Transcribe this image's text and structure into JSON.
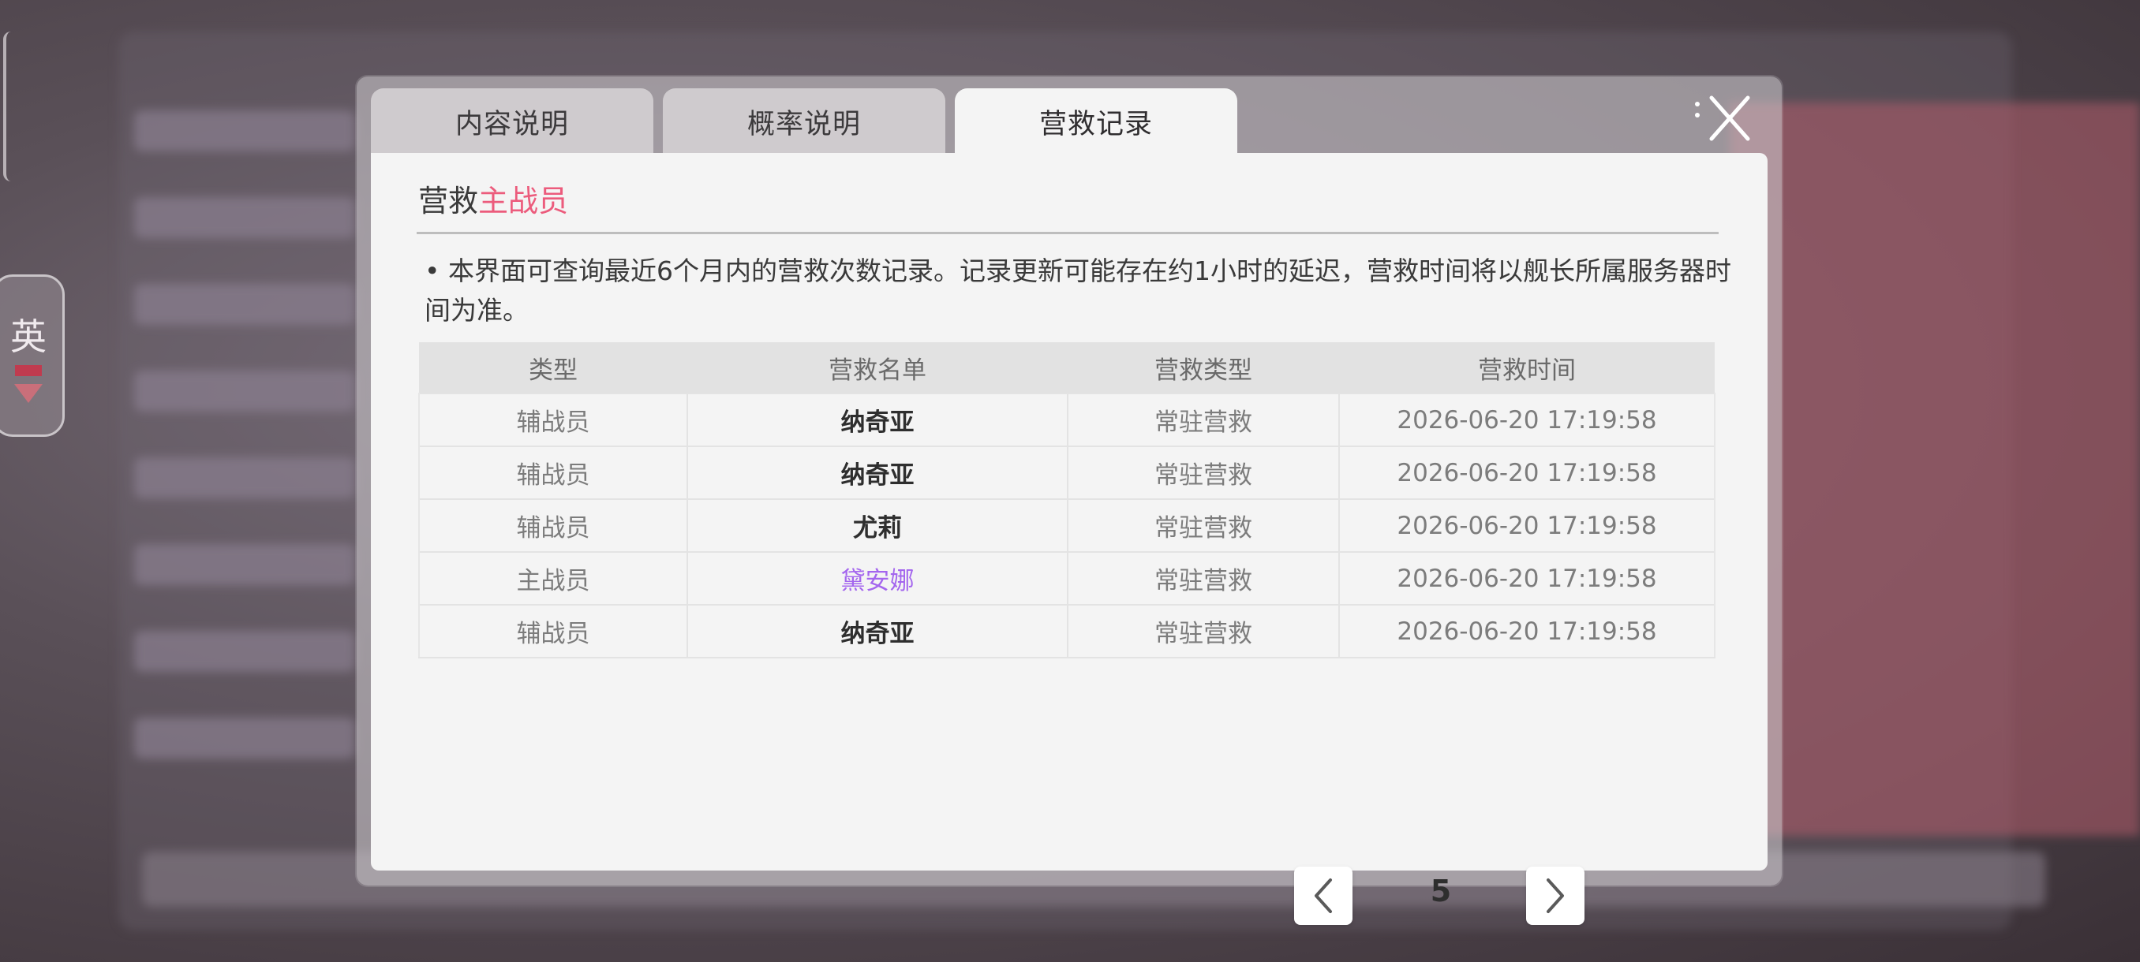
{
  "side_widget": {
    "glyph": "英"
  },
  "tabs": [
    {
      "label": "内容说明",
      "active": false
    },
    {
      "label": "概率说明",
      "active": false
    },
    {
      "label": "营救记录",
      "active": true
    }
  ],
  "section": {
    "title_prefix": "营救",
    "title_accent": "主战员",
    "accent_color": "#ec5b7c"
  },
  "note": "• 本界面可查询最近6个月内的营救次数记录。记录更新可能存在约1小时的延迟，营救时间将以舰长所属服务器时间为准。",
  "table": {
    "headers": [
      "类型",
      "营救名单",
      "营救类型",
      "营救时间"
    ],
    "rows": [
      {
        "type": "辅战员",
        "name": "纳奇亚",
        "rescue_type": "常驻营救",
        "time": "2026-06-20 17:19:58"
      },
      {
        "type": "辅战员",
        "name": "纳奇亚",
        "rescue_type": "常驻营救",
        "time": "2026-06-20 17:19:58"
      },
      {
        "type": "辅战员",
        "name": "尤莉",
        "rescue_type": "常驻营救",
        "time": "2026-06-20 17:19:58"
      },
      {
        "type": "主战员",
        "name": "黛安娜",
        "rescue_type": "常驻营救",
        "time": "2026-06-20 17:19:58",
        "highlight_color": "#a466ee"
      },
      {
        "type": "辅战员",
        "name": "纳奇亚",
        "rescue_type": "常驻营救",
        "time": "2026-06-20 17:19:58"
      }
    ]
  },
  "pager": {
    "page": "5",
    "prev_icon": "chevron-left-icon",
    "next_icon": "chevron-right-icon"
  },
  "close_icon": "close-icon"
}
